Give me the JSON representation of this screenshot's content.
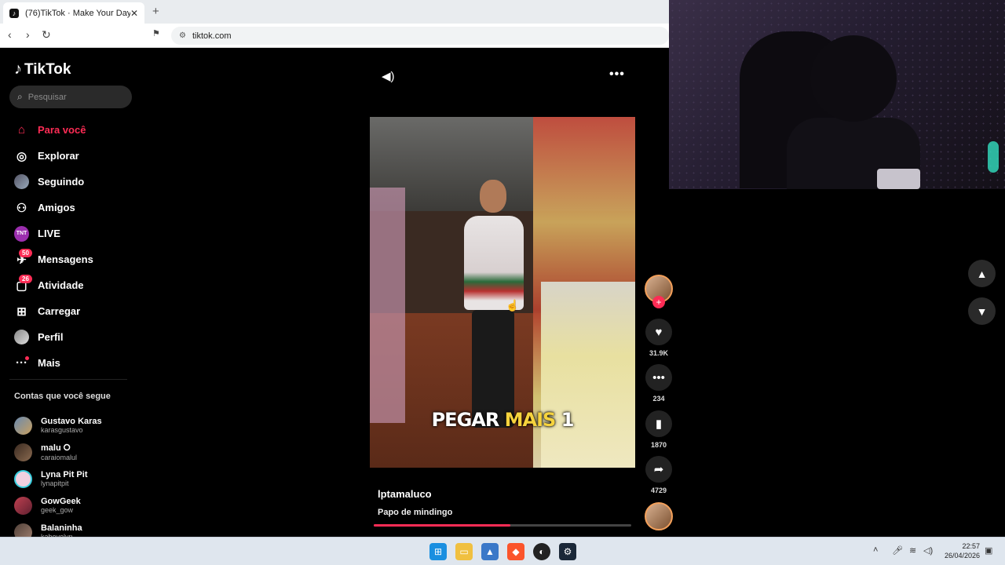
{
  "browser": {
    "tab_title": "(76)TikTok · Make Your Day",
    "tab_favicon": "tiktok-icon",
    "tab_close": "✕",
    "new_tab": "+",
    "url": "tiktok.com",
    "nav": {
      "back": "‹",
      "forward": "›",
      "reload": "↻",
      "bookmark": "🔖"
    }
  },
  "sidebar": {
    "logo": "TikTok",
    "search_placeholder": "Pesquisar",
    "items": [
      {
        "label": "Para você",
        "icon": "home-icon",
        "active": true
      },
      {
        "label": "Explorar",
        "icon": "compass-icon"
      },
      {
        "label": "Seguindo",
        "icon": "following-avatar-icon"
      },
      {
        "label": "Amigos",
        "icon": "friends-icon"
      },
      {
        "label": "LIVE",
        "icon": "live-icon"
      },
      {
        "label": "Mensagens",
        "icon": "messages-icon",
        "badge": "50"
      },
      {
        "label": "Atividade",
        "icon": "activity-icon",
        "badge": "26"
      },
      {
        "label": "Carregar",
        "icon": "upload-icon"
      },
      {
        "label": "Perfil",
        "icon": "profile-avatar-icon"
      },
      {
        "label": "Mais",
        "icon": "more-icon"
      }
    ],
    "following_title": "Contas que você segue",
    "following": [
      {
        "name": "Gustavo Karas",
        "handle": "karasgustavo"
      },
      {
        "name": "malu ⭘",
        "handle": "caraiomalul"
      },
      {
        "name": "Lyna Pit Pit",
        "handle": "lynapitpit"
      },
      {
        "name": "GowGeek",
        "handle": "geek_gow"
      },
      {
        "name": "Balaninha",
        "handle": "kabevelyn"
      }
    ]
  },
  "video": {
    "caption_prefix": "PEGAR ",
    "caption_highlight": "MAIS",
    "caption_suffix": " 1",
    "author": "lptamaluco",
    "description": "Papo de mindingo",
    "progress_percent": 53
  },
  "actions": {
    "likes": "31.9K",
    "comments": "234",
    "saves": "1870",
    "shares": "4729",
    "follow_plus": "+"
  },
  "taskbar": {
    "time": "22:57",
    "date": "26/04/2026"
  },
  "colors": {
    "accent": "#fe2c55",
    "caption_highlight": "#f6d33d"
  }
}
